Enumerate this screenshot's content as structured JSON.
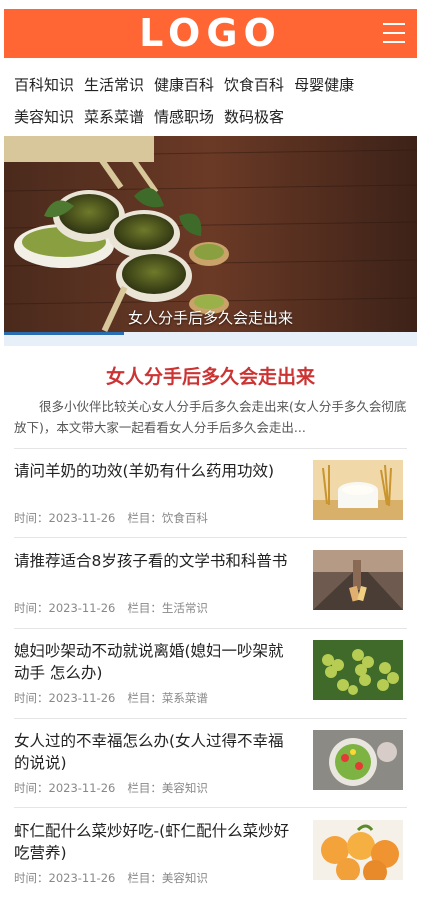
{
  "header": {
    "logo": "LOGO"
  },
  "nav": {
    "row1": [
      "百科知识",
      "生活常识",
      "健康百科",
      "饮食百科",
      "母婴健康"
    ],
    "row2": [
      "美容知识",
      "菜系菜谱",
      "情感职场",
      "数码极客"
    ]
  },
  "banner": {
    "caption": "女人分手后多久会走出来"
  },
  "article": {
    "title": "女人分手后多久会走出来",
    "summary": "很多小伙伴比较关心女人分手后多久会走出来(女人分手多久会彻底放下)，本文带大家一起看看女人分手后多久会走出..."
  },
  "list": [
    {
      "title": "请问羊奶的功效(羊奶有什么药用功效)",
      "time_label": "时间：2023-11-26",
      "column_label": "栏目：饮食百科",
      "thumb": "milk-wheat"
    },
    {
      "title": "请推荐适合8岁孩子看的文学书和科普书",
      "time_label": "时间：2023-11-26",
      "column_label": "栏目：生活常识",
      "thumb": "runner-road"
    },
    {
      "title": "媳妇吵架动不动就说离婚(媳妇一吵架就动手 怎么办)",
      "time_label": "时间：2023-11-26",
      "column_label": "栏目：菜系菜谱",
      "thumb": "grapes"
    },
    {
      "title": "女人过的不幸福怎么办(女人过得不幸福的说说)",
      "time_label": "时间：2023-11-26",
      "column_label": "栏目：美容知识",
      "thumb": "salad-plate"
    },
    {
      "title": "虾仁配什么菜炒好吃-(虾仁配什么菜炒好吃营养)",
      "time_label": "时间：2023-11-26",
      "column_label": "栏目：美容知识",
      "thumb": "apricots"
    }
  ]
}
